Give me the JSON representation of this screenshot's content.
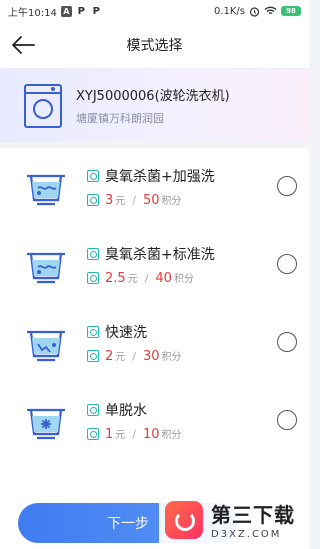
{
  "status_bar": {
    "time": "上午10:14",
    "network": "0.1K/s",
    "battery": "98"
  },
  "nav": {
    "title": "模式选择"
  },
  "device": {
    "name": "XYJ5000006(波轮洗衣机)",
    "location": "塘厦镇万科朗润园"
  },
  "modes": [
    {
      "name": "臭氧杀菌+加强洗",
      "price": "3",
      "price_unit": "元",
      "points": "50",
      "points_unit": "积分",
      "selected": false
    },
    {
      "name": "臭氧杀菌+标准洗",
      "price": "2.5",
      "price_unit": "元",
      "points": "40",
      "points_unit": "积分",
      "selected": false
    },
    {
      "name": "快速洗",
      "price": "2",
      "price_unit": "元",
      "points": "30",
      "points_unit": "积分",
      "selected": false
    },
    {
      "name": "单脱水",
      "price": "1",
      "price_unit": "元",
      "points": "10",
      "points_unit": "积分",
      "selected": false
    }
  ],
  "separator": "/",
  "next_button": {
    "label": "下一步"
  },
  "watermark": {
    "title": "第三下载",
    "url": "D3XZ.COM"
  },
  "colors": {
    "accent": "#3f7cf0",
    "price": "#e23b3b",
    "tag": "#21b8b0",
    "icon": "#3860d4"
  }
}
